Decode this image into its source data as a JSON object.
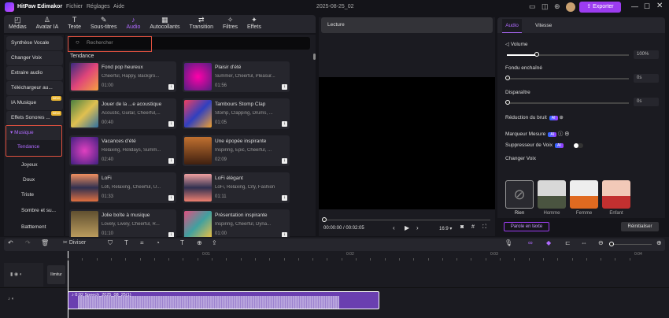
{
  "app": {
    "title": "HitPaw Edimakor",
    "menu": [
      "Fichier",
      "Réglages",
      "Aide"
    ],
    "project": "2025-08-25_02",
    "export": "Exporter"
  },
  "tabs": [
    {
      "label": "Médias",
      "icon": "media-icon"
    },
    {
      "label": "Avatar IA",
      "icon": "avatar-icon"
    },
    {
      "label": "Texte",
      "icon": "text-icon"
    },
    {
      "label": "Sous-titres",
      "icon": "subtitles-icon"
    },
    {
      "label": "Audio",
      "icon": "audio-icon",
      "active": true
    },
    {
      "label": "Autocollants",
      "icon": "stickers-icon"
    },
    {
      "label": "Transition",
      "icon": "transition-icon"
    },
    {
      "label": "Filtres",
      "icon": "filters-icon"
    },
    {
      "label": "Effets",
      "icon": "effects-icon"
    }
  ],
  "sidebar": {
    "items": [
      {
        "label": "Synthèse Vocale"
      },
      {
        "label": "Changer Voix"
      },
      {
        "label": "Extraire audio"
      },
      {
        "label": "Téléchargeur au..."
      },
      {
        "label": "IA Musique",
        "badge": "NEW"
      },
      {
        "label": "Effets Sonores ...",
        "badge": "NEW"
      }
    ],
    "music": "Musique",
    "subs": [
      "Tendance",
      "Joyeux",
      "Doux",
      "Triste",
      "Sombre et su...",
      "Batttement"
    ]
  },
  "search": {
    "placeholder": "Rechercher"
  },
  "section": "Tendance",
  "tracks": [
    {
      "title": "Fond pop heureux",
      "tags": "Cheerful, Happy, Backgro...",
      "duration": "01:00"
    },
    {
      "title": "Plaisir d'été",
      "tags": "Summer, Cheerful, Pleasur...",
      "duration": "01:56"
    },
    {
      "title": "Jouer de la ...e acoustique",
      "tags": "Acoustic, Guitar, Cheerful,...",
      "duration": "00:40"
    },
    {
      "title": "Tambours Stomp Clap",
      "tags": "Stomp, Clapping, Drums, ...",
      "duration": "01:05"
    },
    {
      "title": "Vacances d'été",
      "tags": "Relaxing, Holidays, Summ...",
      "duration": "02:40"
    },
    {
      "title": "Une épopée inspirante",
      "tags": "Inspiring, Epic, Cheerful, ...",
      "duration": "02:09"
    },
    {
      "title": "LoFi",
      "tags": "Lofi, Relaxing, Cheerful, U...",
      "duration": "01:33"
    },
    {
      "title": "LoFi élégant",
      "tags": "LoFi, Relaxing, City, Fashion",
      "duration": "01:11"
    },
    {
      "title": "Jolie boîte à musique",
      "tags": "Lovely, Lively, Cheerful, R...",
      "duration": "01:10"
    },
    {
      "title": "Présentation inspirante",
      "tags": "Inspiring, Cheerful, Dyna...",
      "duration": "01:00"
    }
  ],
  "preview": {
    "title": "Lecture",
    "time": "00:00:00 / 00:02:05",
    "ratio": "16:9"
  },
  "panel": {
    "tabs": [
      "Audio",
      "Vitesse"
    ],
    "volume_label": "Volume",
    "volume": "100%",
    "volume_level": 0.25,
    "fade_in_label": "Fondu enchaîné",
    "fade_in": "0s",
    "fade_out_label": "Disparaître",
    "fade_out": "0s",
    "noise": "Réduction du bruit",
    "beat": "Marqueur Mesure",
    "vocal": "Suppresseur de Voix",
    "ai": "AI",
    "changer": "Changer Voix",
    "voices": [
      "Rien",
      "Homme",
      "Femme",
      "Enfant"
    ],
    "speech": "Parole en texte",
    "reset": "Réinitialiser"
  },
  "timeline": {
    "split": "Diviser",
    "ticks": [
      "00:00",
      "0:01",
      "0:02",
      "0:03",
      "0:04"
    ],
    "track_label": "Ilimitur",
    "clip": "0:02 Speech_2025_08_25(1)"
  }
}
